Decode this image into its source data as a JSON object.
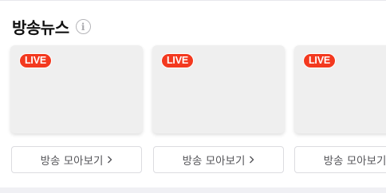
{
  "section": {
    "title": "방송뉴스",
    "info_icon": "info-icon"
  },
  "cards": [
    {
      "badge": "LIVE",
      "button_label": "방송 모아보기"
    },
    {
      "badge": "LIVE",
      "button_label": "방송 모아보기"
    },
    {
      "badge": "LIVE",
      "button_label": "방송 모아보기"
    }
  ],
  "colors": {
    "live_badge": "#f3391f",
    "card_bg": "#efefef",
    "page_bg": "#f0f0f4"
  }
}
